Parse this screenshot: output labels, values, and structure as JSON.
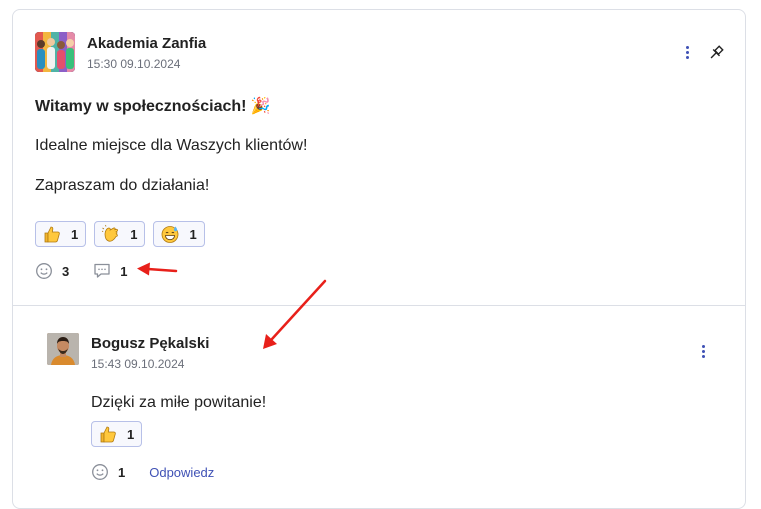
{
  "post": {
    "author": "Akademia Zanfia",
    "time": "15:30 09.10.2024",
    "title": "Witamy w społecznościach! 🎉",
    "paragraphs": [
      "Idealne miejsce dla Waszych klientów!",
      "Zapraszam do działania!"
    ],
    "reactions": [
      {
        "icon": "thumbs-up-emoji",
        "count": "1"
      },
      {
        "icon": "clapping-hands-emoji",
        "count": "1"
      },
      {
        "icon": "grinning-sweat-emoji",
        "count": "1"
      }
    ],
    "reactions_total": "3",
    "comments_count": "1"
  },
  "comment": {
    "author": "Bogusz Pękalski",
    "time": "15:43 09.10.2024",
    "text": "Dzięki za miłe powitanie!",
    "reactions": [
      {
        "icon": "thumbs-up-emoji",
        "count": "1"
      }
    ],
    "reactions_total": "1",
    "reply_label": "Odpowiedz"
  },
  "colors": {
    "accent": "#3f51b5",
    "annotation_arrow": "#e8201a",
    "border": "#dcdfe6"
  }
}
